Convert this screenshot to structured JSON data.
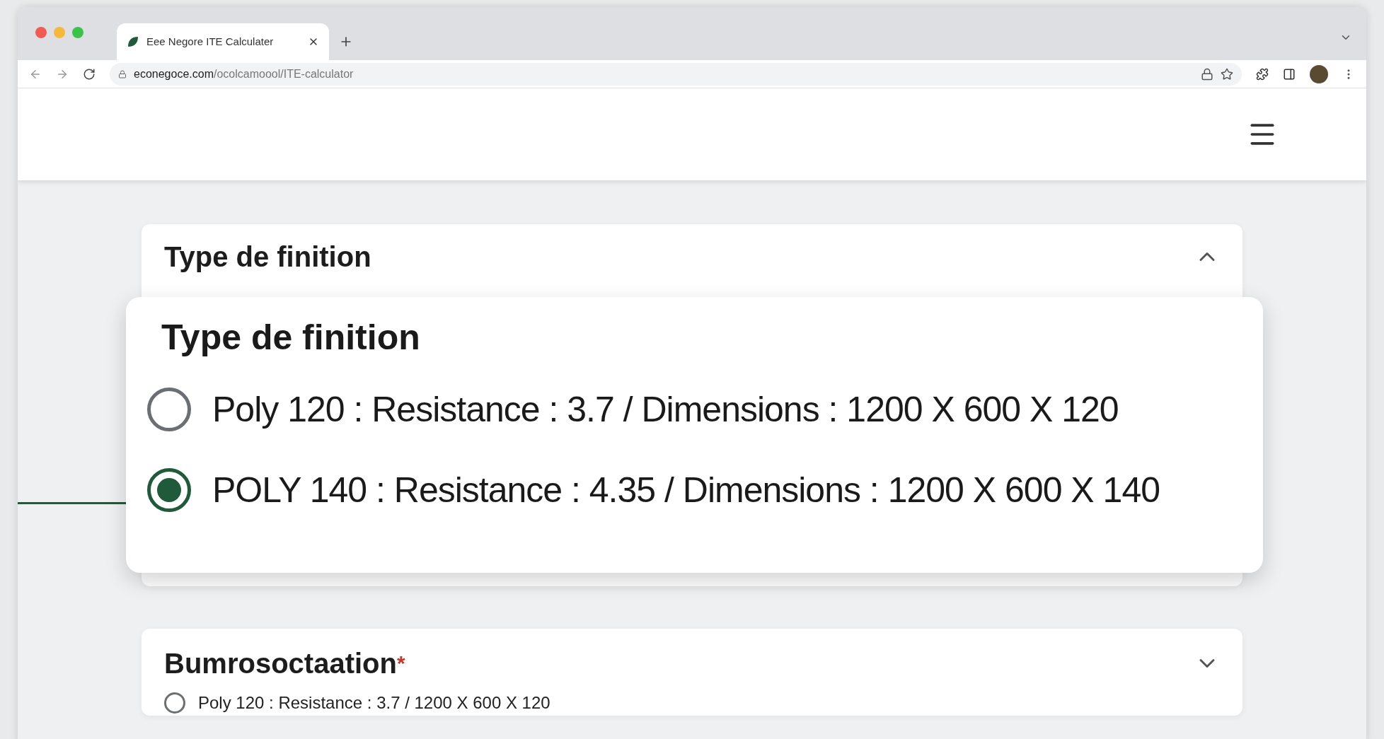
{
  "browser": {
    "tab_title": "Eee Negore ITE Calculater",
    "url_domain": "econegoce.com",
    "url_path": "/ocolcamoool/ITE-calculator"
  },
  "popup": {
    "title": "Type de finition",
    "options": [
      {
        "label": "Poly 120 : Resistance : 3.7 / Dimensions : 1200 X 600 X 120",
        "selected": false
      },
      {
        "label": "POLY 140 : Resistance : 4.35 / Dimensions : 1200 X 600 X 140",
        "selected": true
      }
    ]
  },
  "panels": [
    {
      "title": "Type de finition",
      "expanded": true
    },
    {
      "title": "Bumrosoctaation",
      "required_mark": "*",
      "expanded": false,
      "options": [
        {
          "label": "Poly 120 : Resistance : 3.7 / 1200 X 600 X 120",
          "selected": false
        }
      ]
    }
  ]
}
